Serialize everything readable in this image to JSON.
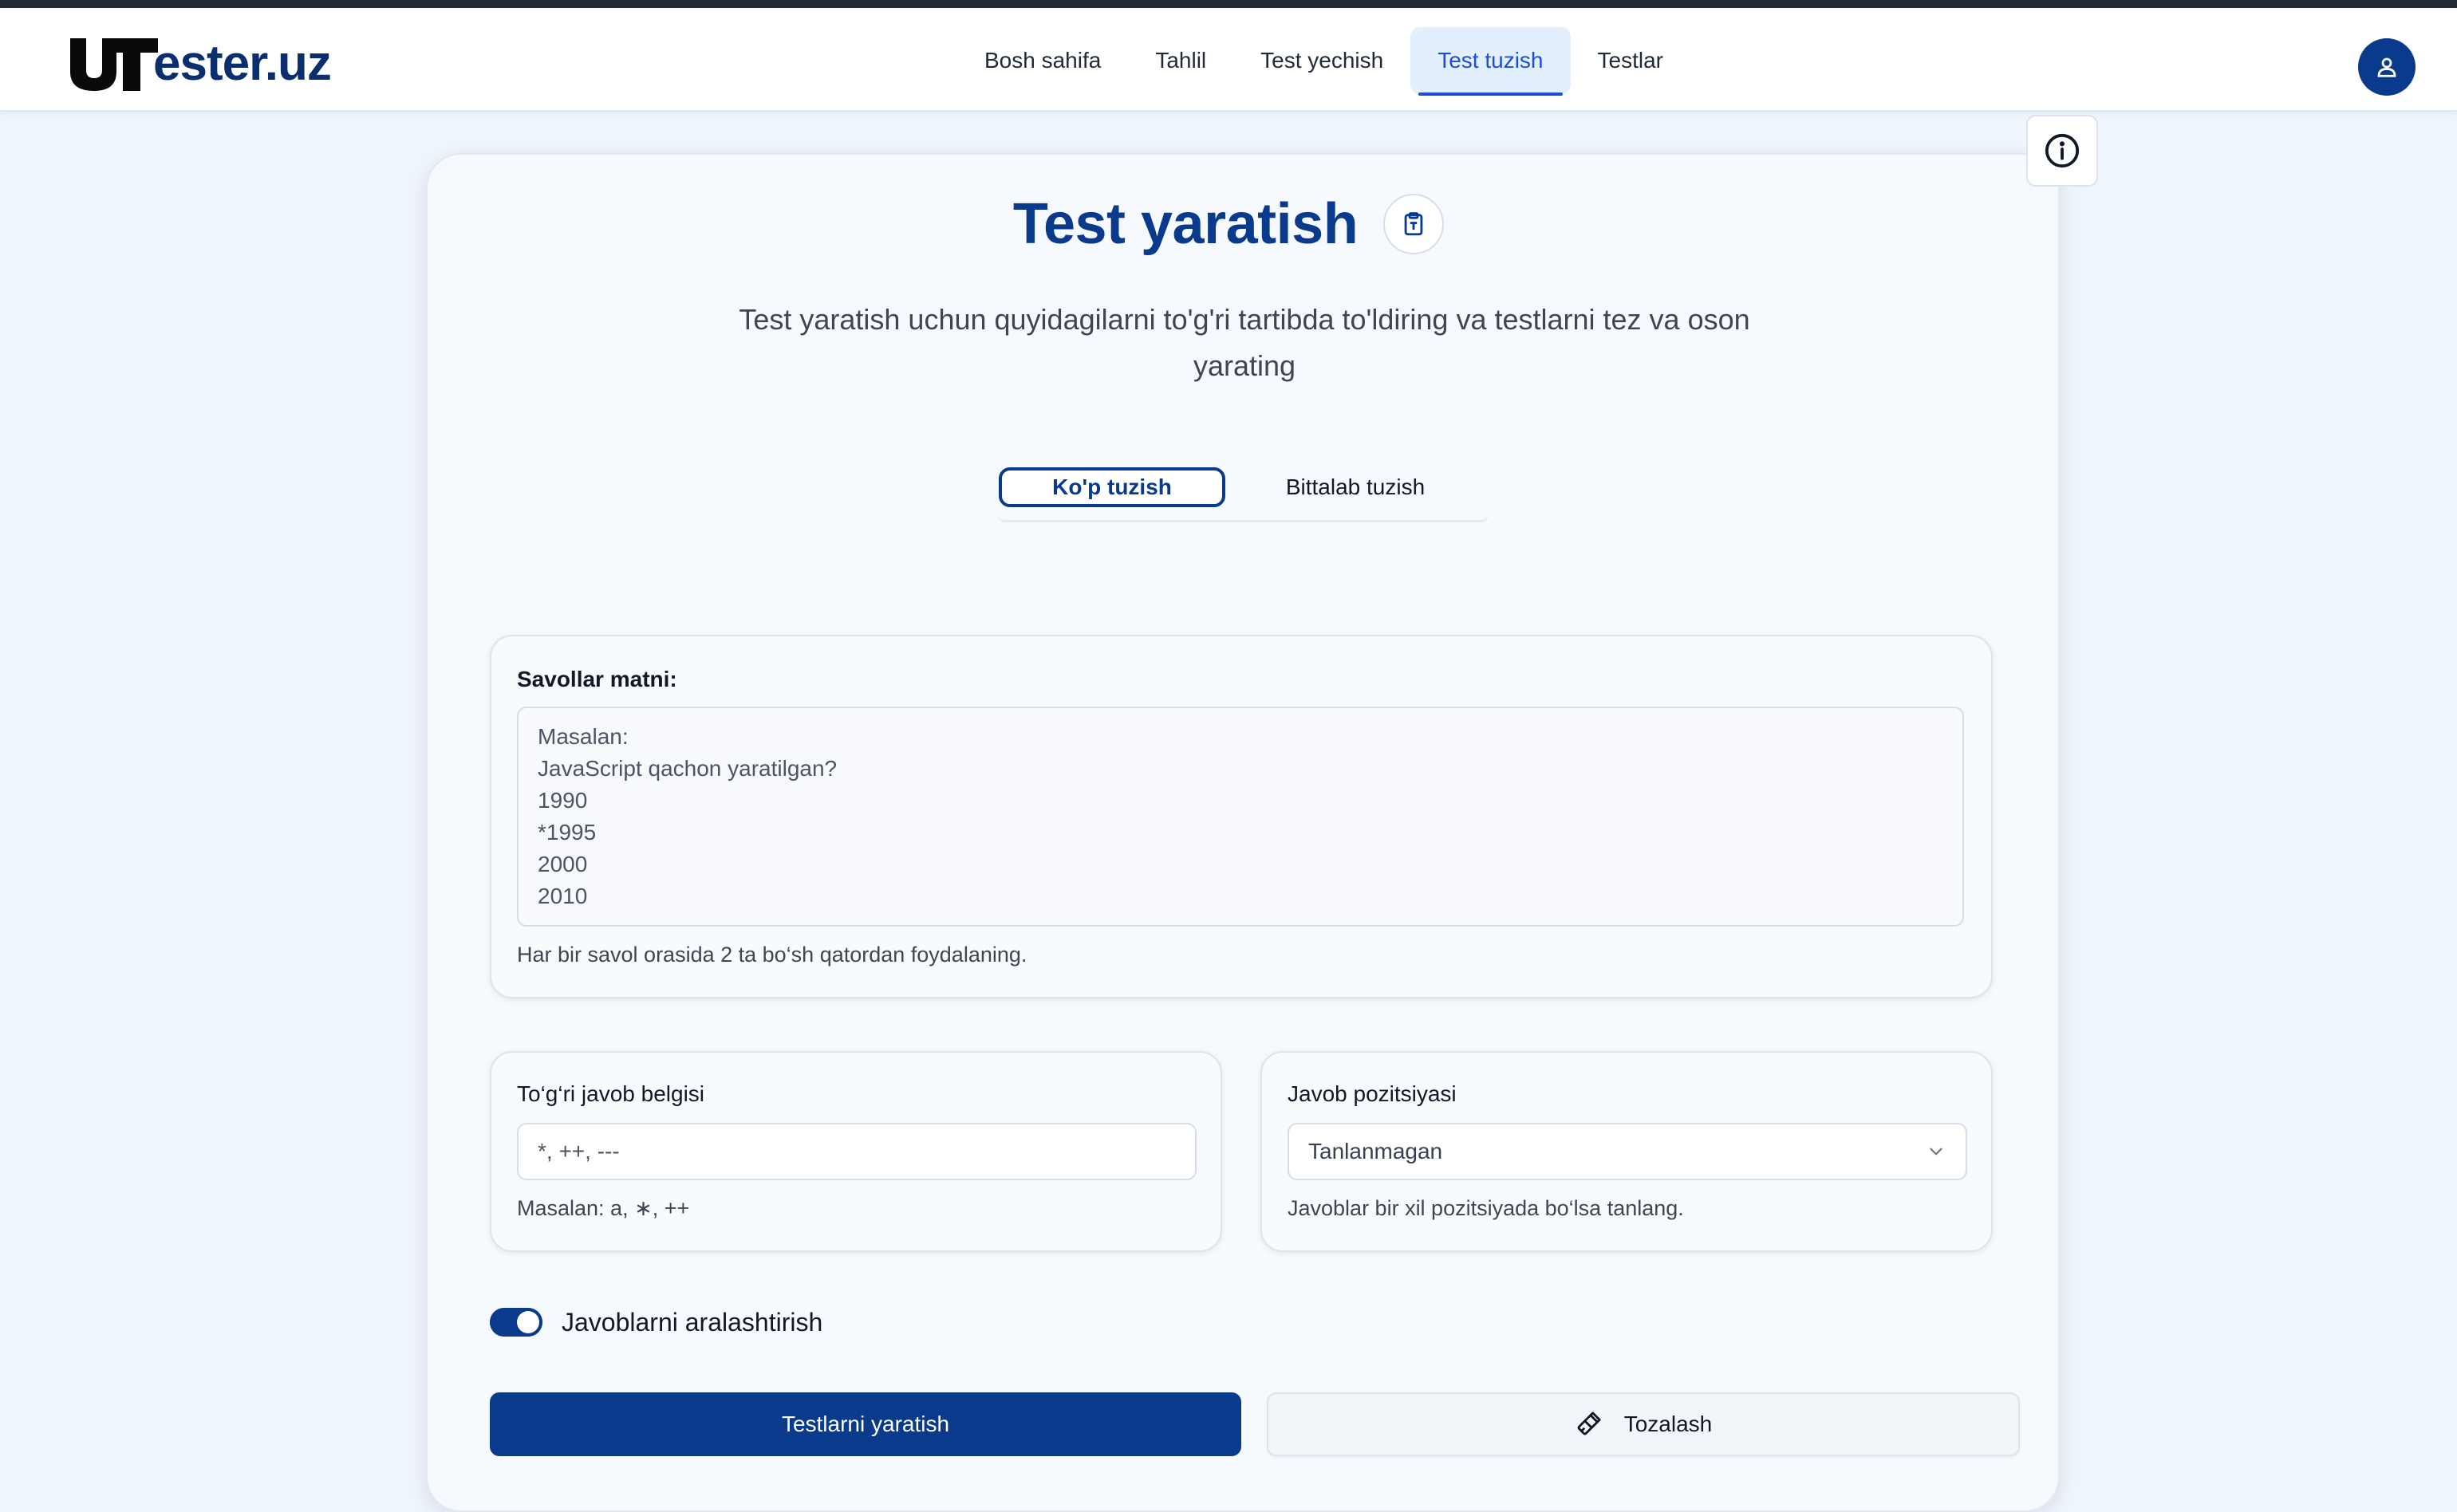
{
  "app": {
    "logo_text": "ester.uz",
    "logo_alt": "UTester.uz"
  },
  "nav": {
    "items": [
      {
        "label": "Bosh sahifa"
      },
      {
        "label": "Tahlil"
      },
      {
        "label": "Test yechish"
      },
      {
        "label": "Test tuzish",
        "active": true
      },
      {
        "label": "Testlar"
      }
    ]
  },
  "icons": {
    "avatar": "user-icon",
    "info": "info-icon",
    "title": "clipboard-icon",
    "dropdown": "chevron-down-icon",
    "clear": "brush-icon"
  },
  "page": {
    "title": "Test yaratish",
    "subtitle": "Test yaratish uchun quyidagilarni to'g'ri tartibda to'ldiring va testlarni tez va oson yarating"
  },
  "tabs": {
    "bulk": "Ko'p tuzish",
    "single": "Bittalab tuzish",
    "active": "bulk"
  },
  "questions": {
    "label": "Savollar matni:",
    "placeholder_lines": [
      "Masalan:",
      "JavaScript qachon yaratilgan?",
      "1990",
      "*1995",
      "2000",
      "2010"
    ],
    "hint": "Har bir savol orasida 2 ta bo‘sh qatordan foydalaning."
  },
  "answer_mark": {
    "label": "To‘g‘ri javob belgisi",
    "placeholder": "*, ++, ---",
    "hint": "Masalan: a, ∗, ++"
  },
  "answer_position": {
    "label": "Javob pozitsiyasi",
    "selected": "Tanlanmagan",
    "hint": "Javoblar bir xil pozitsiyada bo‘lsa tanlang."
  },
  "shuffle": {
    "label": "Javoblarni aralashtirish",
    "on": true
  },
  "actions": {
    "create": "Testlarni yaratish",
    "clear": "Tozalash"
  },
  "colors": {
    "brand": "#0a3a8c",
    "nav_active": "#1d4ed8",
    "background": "#eef5fd"
  }
}
